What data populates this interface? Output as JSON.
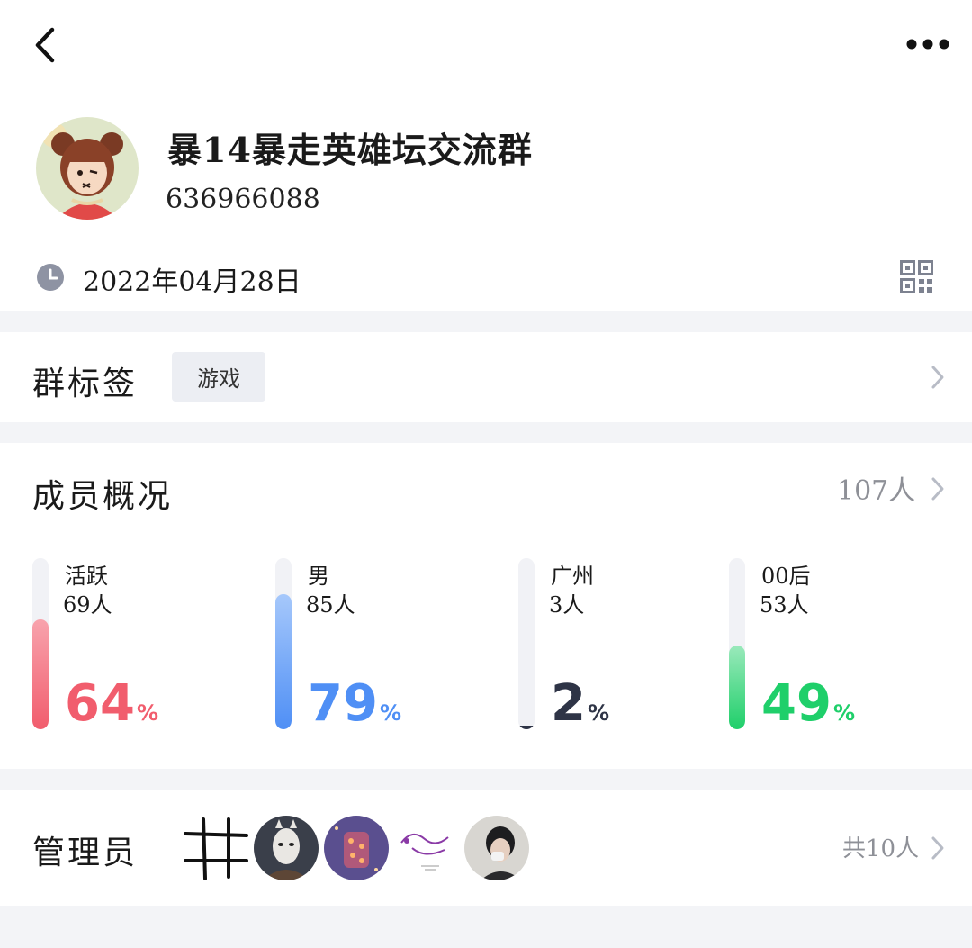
{
  "header": {
    "back_icon": "chevron-left-icon",
    "more_icon": "more-horizontal-icon"
  },
  "group": {
    "name": "暴14暴走英雄坛交流群",
    "id": "636966088",
    "created_date": "2022年04月28日",
    "avatar_icon": "cartoon-girl-avatar",
    "qr_icon": "qr-code-icon"
  },
  "tags_section": {
    "title": "群标签",
    "tags": [
      "游戏"
    ]
  },
  "overview": {
    "title": "成员概况",
    "member_count": "107人",
    "stats": [
      {
        "label": "活跃",
        "count": "69人",
        "percent": "64",
        "percent_sign": "%",
        "fill": 0.64,
        "color": "#f15d6d",
        "light": "#f8a3ad"
      },
      {
        "label": "男",
        "count": "85人",
        "percent": "79",
        "percent_sign": "%",
        "fill": 0.79,
        "color": "#4f8ff5",
        "light": "#a6c8fb"
      },
      {
        "label": "广州",
        "count": "3人",
        "percent": "2",
        "percent_sign": "%",
        "fill": 0.02,
        "color": "#2e3446",
        "light": "#2e3446"
      },
      {
        "label": "00后",
        "count": "53人",
        "percent": "49",
        "percent_sign": "%",
        "fill": 0.49,
        "color": "#1fcf6a",
        "light": "#9ae9bb"
      }
    ]
  },
  "admins": {
    "title": "管理员",
    "total": "共10人",
    "avatars": [
      "grid-sketch-avatar",
      "white-mask-avatar",
      "purple-lights-avatar",
      "dragon-sketch-avatar",
      "person-portrait-avatar"
    ]
  },
  "colors": {
    "background": "#f3f4f7",
    "card": "#ffffff",
    "muted_text": "#8e9097",
    "tag_bg": "#eceef3"
  }
}
